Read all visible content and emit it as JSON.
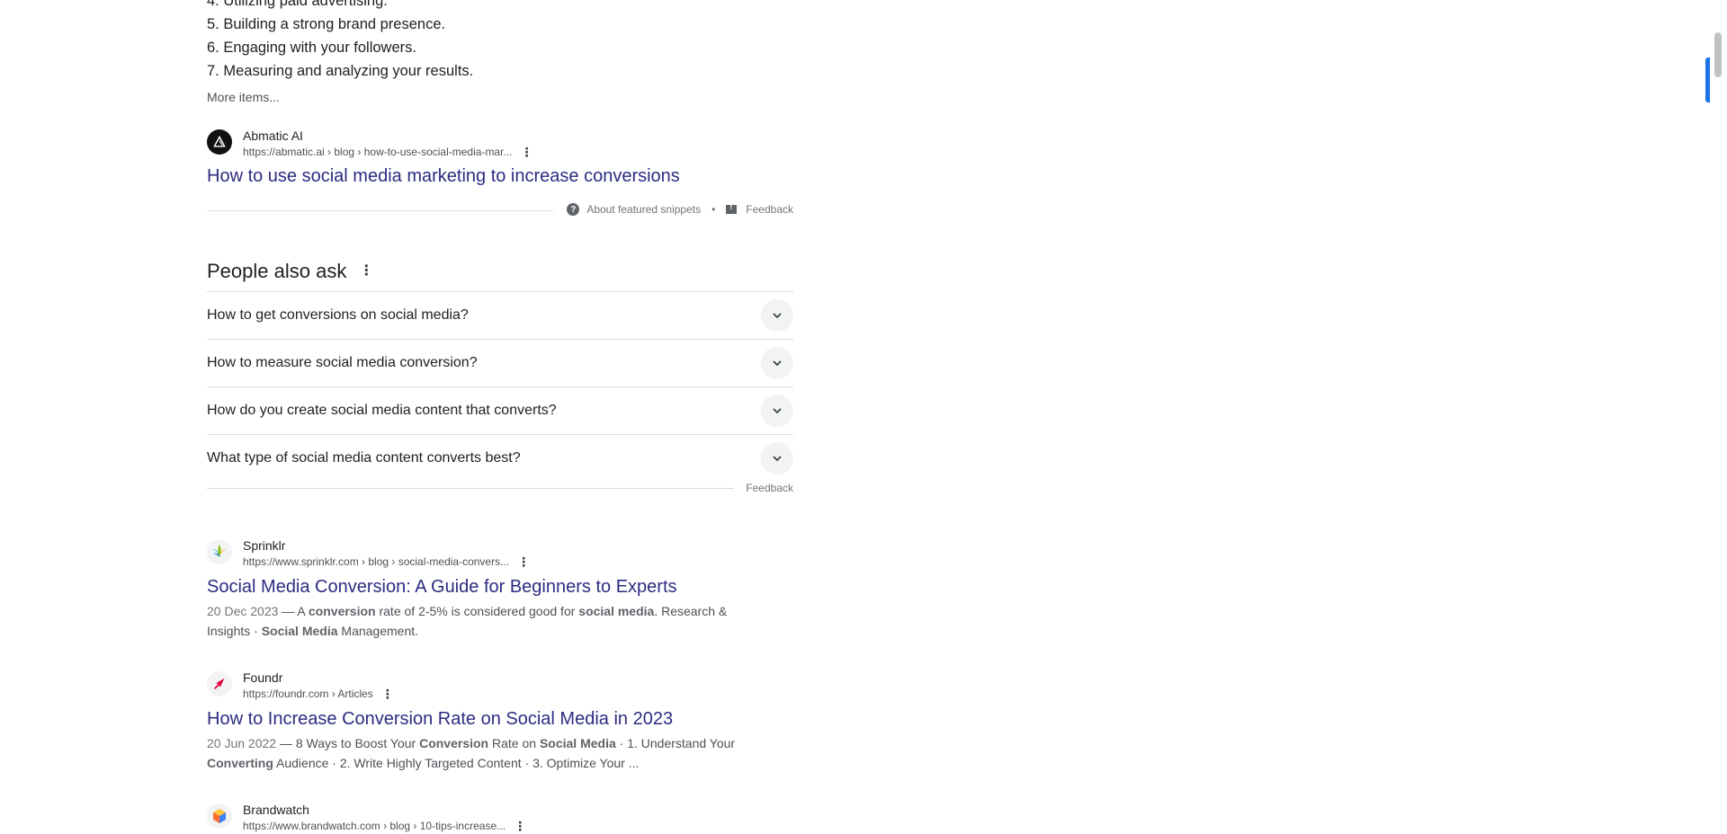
{
  "snippet": {
    "list_items": [
      "4. Utilizing paid advertising.",
      "5. Building a strong brand presence.",
      "6. Engaging with your followers.",
      "7. Measuring and analyzing your results."
    ],
    "more_items": "More items...",
    "source_name": "Abmatic AI",
    "source_url": "https://abmatic.ai › blog › how-to-use-social-media-mar...",
    "title": "How to use social media marketing to increase conversions",
    "about_label": "About featured snippets",
    "separator": "•",
    "feedback_label": "Feedback"
  },
  "paa": {
    "heading": "People also ask",
    "questions": [
      "How to get conversions on social media?",
      "How to measure social media conversion?",
      "How do you create social media content that converts?",
      "What type of social media content converts best?"
    ],
    "feedback_label": "Feedback"
  },
  "results": [
    {
      "site": "Sprinklr",
      "url": "https://www.sprinklr.com › blog › social-media-convers...",
      "title": "Social Media Conversion: A Guide for Beginners to Experts",
      "date": "20 Dec 2023",
      "dash": " — ",
      "s1": "A ",
      "b1": "conversion",
      "s2": " rate of 2-5% is considered good for ",
      "b2": "social media",
      "s3": ". Research & Insights · ",
      "b3": "Social Media",
      "s4": " Management."
    },
    {
      "site": "Foundr",
      "url": "https://foundr.com › Articles",
      "title": "How to Increase Conversion Rate on Social Media in 2023",
      "date": "20 Jun 2022",
      "dash": " — ",
      "s1": "8 Ways to Boost Your ",
      "b1": "Conversion",
      "s2": " Rate on ",
      "b2": "Social Media",
      "s3": " · 1. Understand Your ",
      "b3": "Converting",
      "s4": " Audience · 2. Write Highly Targeted Content · 3. Optimize Your ..."
    },
    {
      "site": "Brandwatch",
      "url": "https://www.brandwatch.com › blog › 10-tips-increase..."
    }
  ],
  "icons": {
    "menu": "three-dot-menu-icon",
    "chevron": "chevron-down-icon",
    "help": "question-circle-icon",
    "feedback": "feedback-icon"
  },
  "colors": {
    "link_title": "#2c2c82",
    "accent": "#1a73e8"
  }
}
